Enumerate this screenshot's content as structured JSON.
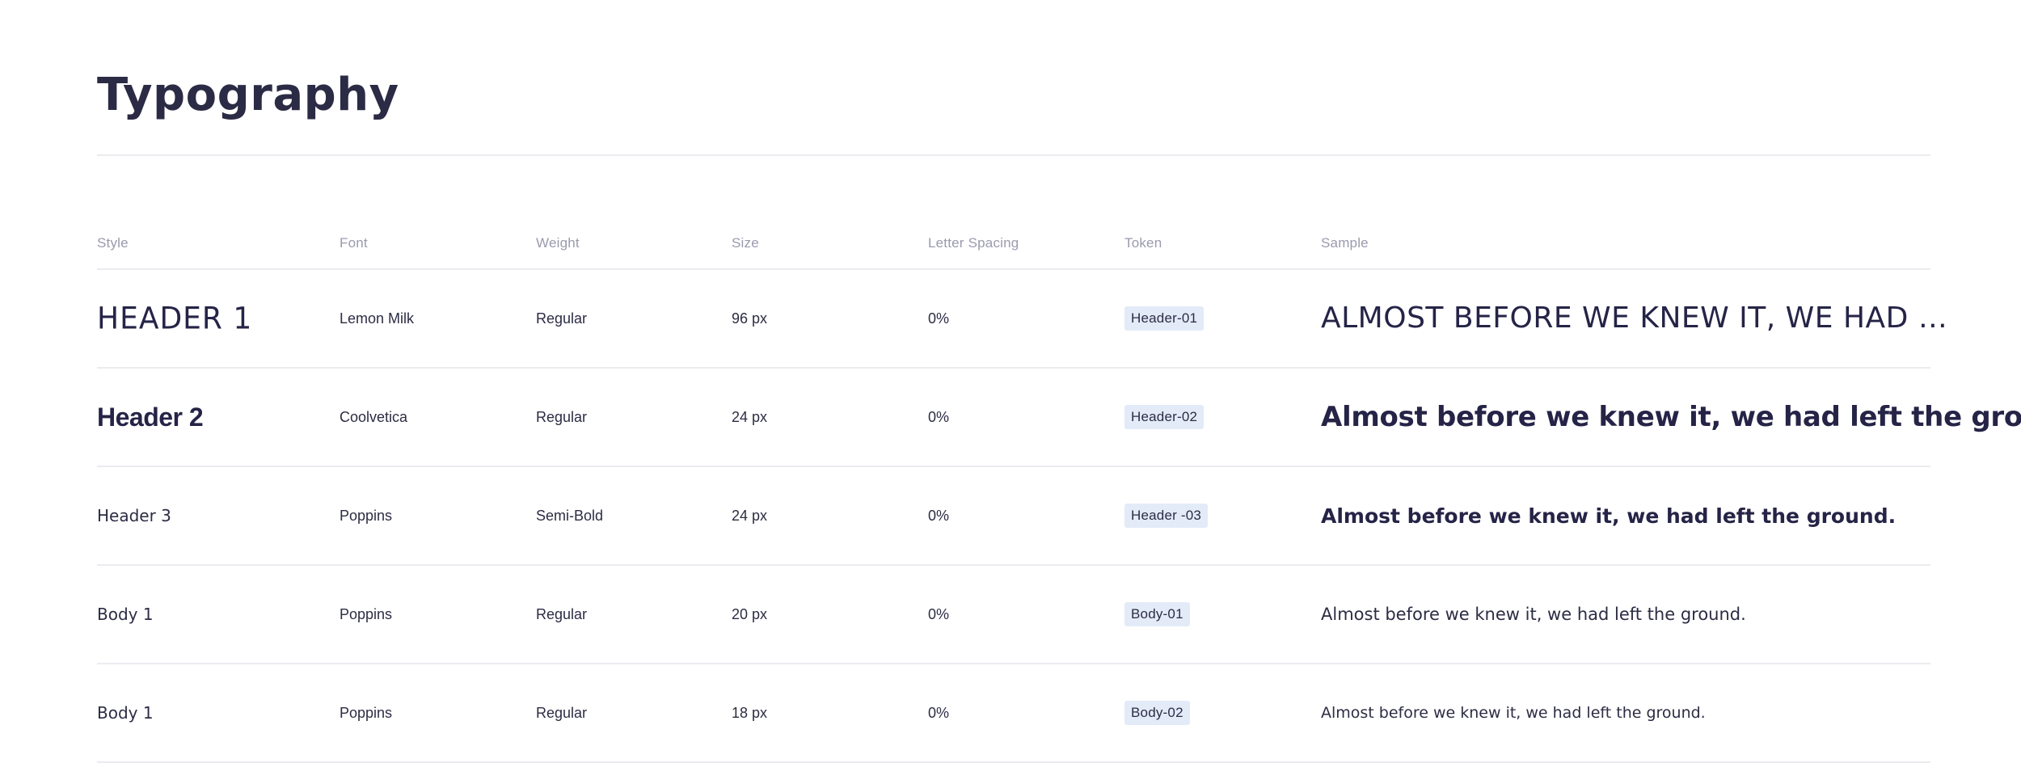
{
  "page": {
    "title": "Typography"
  },
  "table": {
    "columns": [
      "Style",
      "Font",
      "Weight",
      "Size",
      "Letter Spacing",
      "Token",
      "Sample"
    ],
    "rows": [
      {
        "style": "HEADER 1",
        "font": "Lemon Milk",
        "weight": "Regular",
        "size": "96 px",
        "letter_spacing": "0%",
        "token": "Header-01",
        "sample": "ALMOST BEFORE WE KNEW IT, WE HAD LEFT THE GROUND."
      },
      {
        "style": "Header 2",
        "font": "Coolvetica",
        "weight": "Regular",
        "size": "24 px",
        "letter_spacing": "0%",
        "token": "Header-02",
        "sample": "Almost before we knew it, we had left the ground."
      },
      {
        "style": "Header 3",
        "font": "Poppins",
        "weight": "Semi-Bold",
        "size": "24 px",
        "letter_spacing": "0%",
        "token": "Header -03",
        "sample": "Almost before we knew it, we had left the ground."
      },
      {
        "style": "Body 1",
        "font": "Poppins",
        "weight": "Regular",
        "size": "20 px",
        "letter_spacing": "0%",
        "token": "Body-01",
        "sample": "Almost before we knew it, we had left the ground."
      },
      {
        "style": "Body 1",
        "font": "Poppins",
        "weight": "Regular",
        "size": "18 px",
        "letter_spacing": "0%",
        "token": "Body-02",
        "sample": "Almost before we knew it, we had left the ground."
      }
    ]
  },
  "colors": {
    "text_primary": "#252447",
    "text_muted": "#9a9aae",
    "divider": "#ebebf0",
    "token_bg": "#e3ebf8"
  }
}
